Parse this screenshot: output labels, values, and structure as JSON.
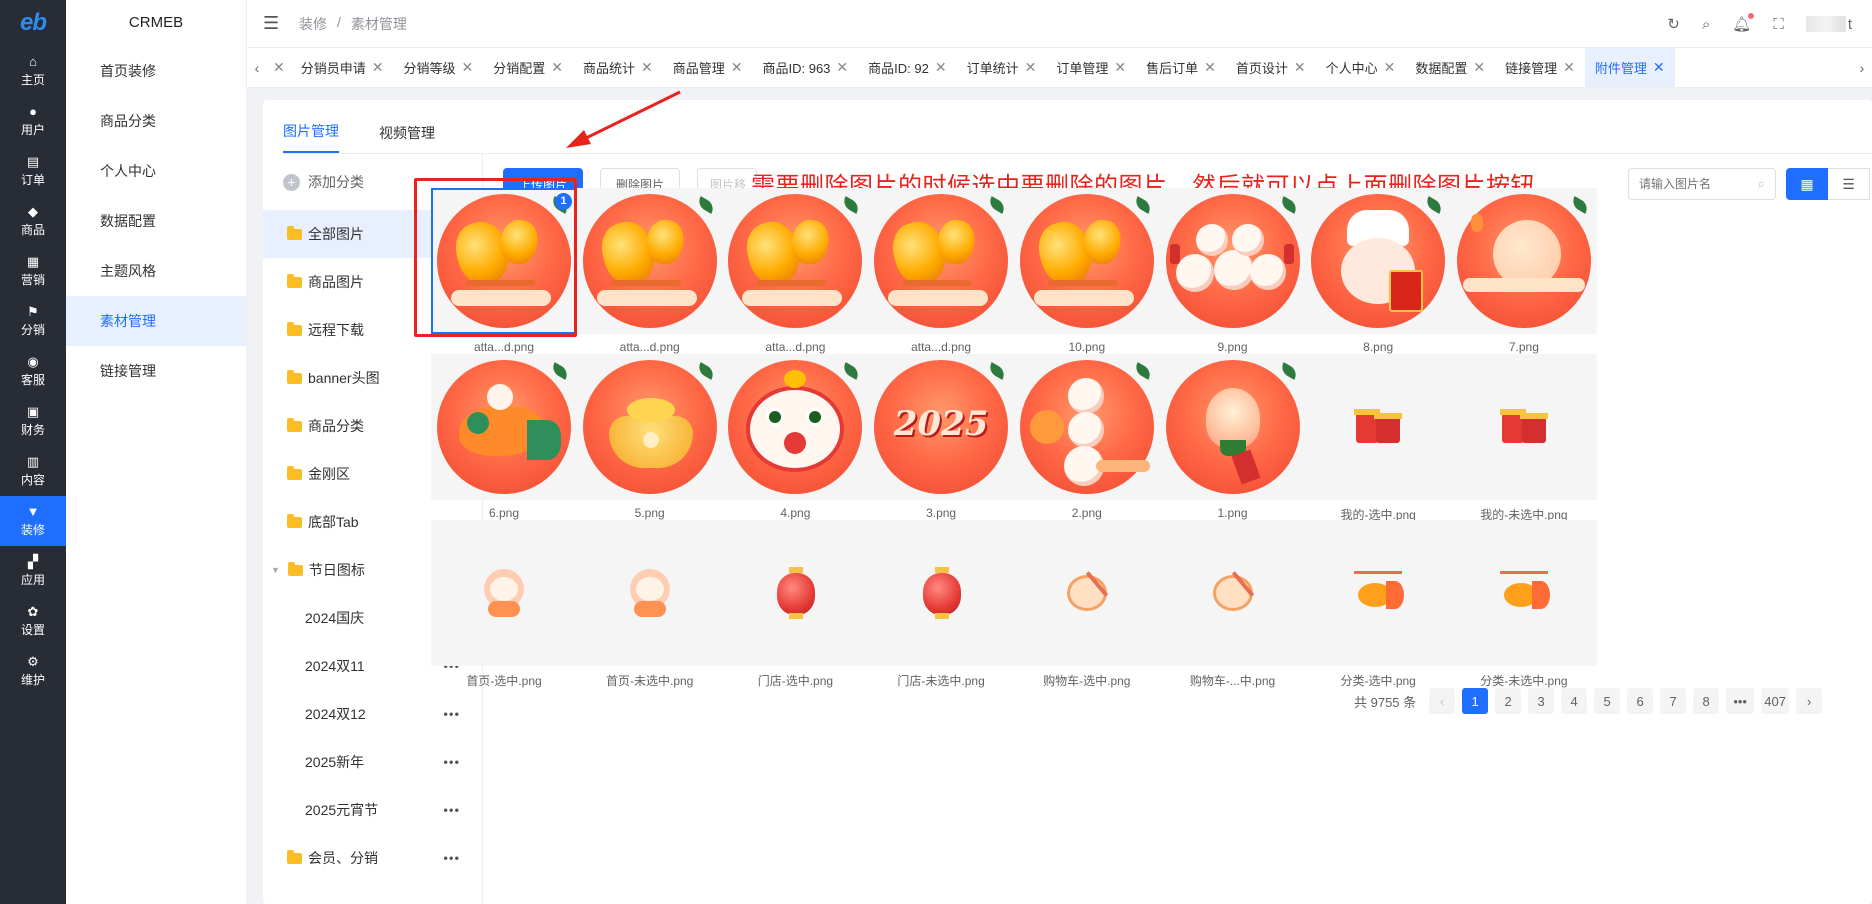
{
  "rail": {
    "logo": "eb",
    "items": [
      {
        "label": "主页",
        "icon": "home-icon",
        "glyph": "⌂"
      },
      {
        "label": "用户",
        "icon": "user-icon",
        "glyph": "●"
      },
      {
        "label": "订单",
        "icon": "order-icon",
        "glyph": "▤"
      },
      {
        "label": "商品",
        "icon": "goods-icon",
        "glyph": "◆"
      },
      {
        "label": "营销",
        "icon": "marketing-icon",
        "glyph": "▦"
      },
      {
        "label": "分销",
        "icon": "distribution-icon",
        "glyph": "⚑"
      },
      {
        "label": "客服",
        "icon": "service-icon",
        "glyph": "◉"
      },
      {
        "label": "财务",
        "icon": "finance-icon",
        "glyph": "▣"
      },
      {
        "label": "内容",
        "icon": "content-icon",
        "glyph": "▥"
      },
      {
        "label": "装修",
        "icon": "decorate-icon",
        "glyph": "▼"
      },
      {
        "label": "应用",
        "icon": "apps-icon",
        "glyph": "▞"
      },
      {
        "label": "设置",
        "icon": "settings-icon",
        "glyph": "✿"
      },
      {
        "label": "维护",
        "icon": "maintain-icon",
        "glyph": "⚙"
      }
    ],
    "active_index": 9
  },
  "sub": {
    "title": "CRMEB",
    "items": [
      "首页装修",
      "商品分类",
      "个人中心",
      "数据配置",
      "主题风格",
      "素材管理",
      "链接管理"
    ],
    "active_index": 5
  },
  "topbar": {
    "crumb1": "装修",
    "sep": "/",
    "crumb2": "素材管理",
    "icons": [
      "refresh-icon",
      "search-icon",
      "bell-icon",
      "fullscreen-icon"
    ],
    "user_suffix": "t"
  },
  "tabs": [
    "分销员申请",
    "分销等级",
    "分销配置",
    "商品统计",
    "商品管理",
    "商品ID: 963",
    "商品ID: 92",
    "订单统计",
    "订单管理",
    "售后订单",
    "首页设计",
    "个人中心",
    "数据配置",
    "链接管理",
    "附件管理"
  ],
  "tabs_active_index": 14,
  "panel": {
    "tab_images": "图片管理",
    "tab_videos": "视频管理"
  },
  "cats": {
    "add_label": "添加分类",
    "items": [
      {
        "label": "全部图片",
        "type": "folder",
        "active": true
      },
      {
        "label": "商品图片",
        "type": "folder"
      },
      {
        "label": "远程下载",
        "type": "folder"
      },
      {
        "label": "banner头图",
        "type": "folder"
      },
      {
        "label": "商品分类",
        "type": "folder"
      },
      {
        "label": "金刚区",
        "type": "folder"
      },
      {
        "label": "底部Tab",
        "type": "folder"
      },
      {
        "label": "节日图标",
        "type": "parent"
      },
      {
        "label": "2024国庆",
        "type": "child"
      },
      {
        "label": "2024双11",
        "type": "child"
      },
      {
        "label": "2024双12",
        "type": "child"
      },
      {
        "label": "2025新年",
        "type": "child"
      },
      {
        "label": "2025元宵节",
        "type": "child"
      },
      {
        "label": "会员、分销",
        "type": "folder"
      }
    ]
  },
  "toolbar": {
    "upload": "上传图片",
    "delete": "删除图片",
    "move": "图片移",
    "annotation": "需要删除图片的时候选中要删除的图片，然后就可以点上面删除图片按钮",
    "search_placeholder": "请输入图片名"
  },
  "images": [
    {
      "name": "atta...d.png",
      "kind": "lantern",
      "selected": true,
      "badge": "1"
    },
    {
      "name": "atta...d.png",
      "kind": "lantern"
    },
    {
      "name": "atta...d.png",
      "kind": "lantern"
    },
    {
      "name": "atta...d.png",
      "kind": "lantern"
    },
    {
      "name": "10.png",
      "kind": "lantern"
    },
    {
      "name": "9.png",
      "kind": "dumplings"
    },
    {
      "name": "8.png",
      "kind": "chef"
    },
    {
      "name": "7.png",
      "kind": "moon"
    },
    {
      "name": "6.png",
      "kind": "fish"
    },
    {
      "name": "5.png",
      "kind": "ingot"
    },
    {
      "name": "4.png",
      "kind": "lion"
    },
    {
      "name": "3.png",
      "kind": "year",
      "text": "2025"
    },
    {
      "name": "2.png",
      "kind": "balls"
    },
    {
      "name": "1.png",
      "kind": "lotus"
    },
    {
      "name": "我的-选中.png",
      "kind": "gift",
      "small": true
    },
    {
      "name": "我的-未选中.png",
      "kind": "gift",
      "small": true
    },
    {
      "name": "首页-选中.png",
      "kind": "snake",
      "small": true
    },
    {
      "name": "首页-未选中.png",
      "kind": "snake",
      "small": true
    },
    {
      "name": "门店-选中.png",
      "kind": "redlantern",
      "small": true
    },
    {
      "name": "门店-未选中.png",
      "kind": "redlantern",
      "small": true
    },
    {
      "name": "购物车-选中.png",
      "kind": "drum",
      "small": true
    },
    {
      "name": "购物车-...中.png",
      "kind": "drum",
      "small": true
    },
    {
      "name": "分类-选中.png",
      "kind": "goldfish",
      "small": true
    },
    {
      "name": "分类-未选中.png",
      "kind": "goldfish",
      "small": true
    }
  ],
  "pager": {
    "total": "共 9755 条",
    "pages": [
      "1",
      "2",
      "3",
      "4",
      "5",
      "6",
      "7",
      "8",
      "•••",
      "407"
    ],
    "active": "1"
  },
  "colors": {
    "accent": "#1e6fff",
    "annotation": "#e8231d",
    "rail": "#282c34"
  }
}
